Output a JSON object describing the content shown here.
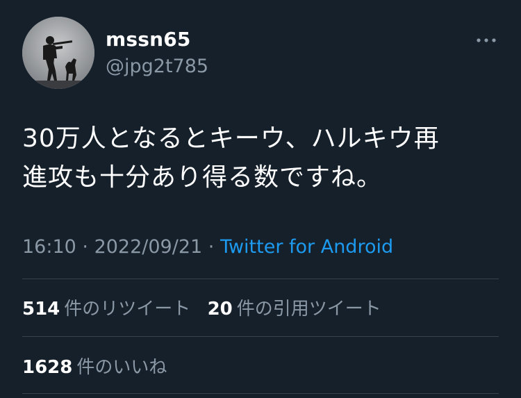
{
  "user": {
    "display_name": "mssn65",
    "handle": "@jpg2t785"
  },
  "tweet": {
    "line1": "30万人となるとキーウ、ハルキウ再",
    "line2": "進攻も十分あり得る数ですね。"
  },
  "meta": {
    "time": "16:10",
    "separator": " · ",
    "date": "2022/09/21",
    "source": "Twitter for Android"
  },
  "stats": {
    "retweets_count": "514",
    "retweets_label": "件のリツイート",
    "quotes_count": "20",
    "quotes_label": "件の引用ツイート",
    "likes_count": "1628",
    "likes_label": "件のいいね"
  },
  "colors": {
    "background": "#15202b",
    "primary_text": "#ffffff",
    "secondary_text": "#8b98a5",
    "link": "#1d9bf0",
    "divider": "#38444d"
  },
  "icons": {
    "more": "more-horizontal-icon"
  }
}
